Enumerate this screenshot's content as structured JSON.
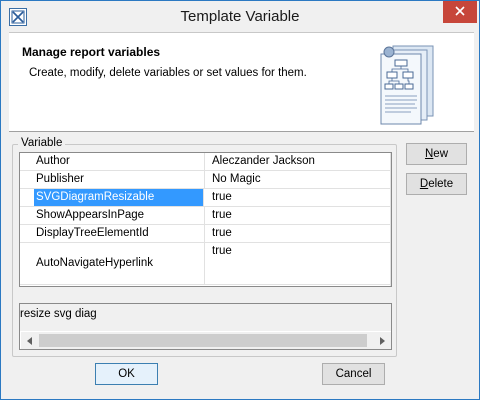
{
  "window": {
    "title": "Template Variable",
    "close_label": "×"
  },
  "header": {
    "title": "Manage report variables",
    "subtitle": "Create, modify, delete variables or set values for them."
  },
  "variable_group": {
    "legend": "Variable",
    "rows": [
      {
        "name": "Author",
        "value": "Aleczander Jackson"
      },
      {
        "name": "Publisher",
        "value": "No Magic"
      },
      {
        "name": "SVGDiagramResizable",
        "value": "true"
      },
      {
        "name": "ShowAppearsInPage",
        "value": "true"
      },
      {
        "name": "DisplayTreeElementId",
        "value": "true"
      },
      {
        "name": "AutoNavigateHyperlink",
        "value": "true"
      }
    ],
    "selected_index": 2,
    "description": "resize svg diag"
  },
  "buttons": {
    "new_mnemonic": "N",
    "new_rest": "ew",
    "delete_mnemonic": "D",
    "delete_rest": "elete",
    "ok": "OK",
    "cancel": "Cancel"
  }
}
